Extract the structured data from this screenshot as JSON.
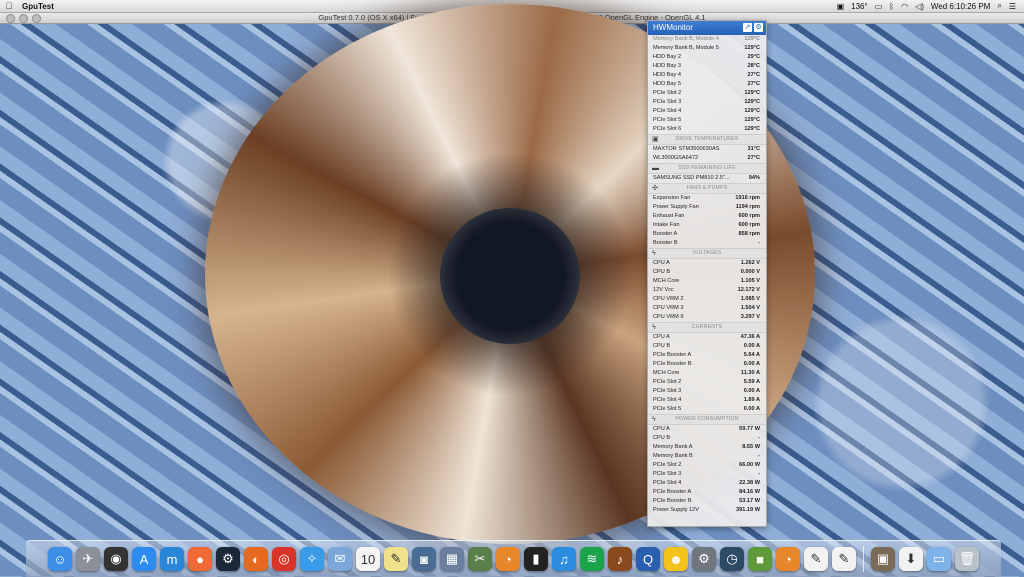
{
  "menubar": {
    "app_name": "GpuTest",
    "temp": "136°",
    "clock": "Wed 6:10:26 PM"
  },
  "gpu_window": {
    "title": "GpuTest 0.7.0 (OS X x64) | FurMark | 61 FPS, 16.959 ms | NVIDIA GeForce GTX 760 OpenGL Engine - OpenGL 4.1"
  },
  "hwmonitor": {
    "title": "HWMonitor",
    "top_rows": [
      {
        "label": "Memory Bank B, Module 4",
        "value": "129°C",
        "dim": true
      },
      {
        "label": "Memory Bank B, Module 5",
        "value": "129°C"
      },
      {
        "label": "HDD Bay 2",
        "value": "29°C"
      },
      {
        "label": "HDD Bay 3",
        "value": "28°C"
      },
      {
        "label": "HDD Bay 4",
        "value": "27°C"
      },
      {
        "label": "HDD Bay 5",
        "value": "27°C"
      },
      {
        "label": "PCIe Slot 2",
        "value": "129°C"
      },
      {
        "label": "PCIe Slot 3",
        "value": "129°C"
      },
      {
        "label": "PCIe Slot 4",
        "value": "129°C"
      },
      {
        "label": "PCIe Slot 5",
        "value": "129°C"
      },
      {
        "label": "PCIe Slot 6",
        "value": "129°C"
      }
    ],
    "sections": [
      {
        "title": "DRIVE TEMPERATURES",
        "icon": "▣",
        "rows": [
          {
            "label": "MAXTOR STM3500630AS",
            "value": "31°C"
          },
          {
            "label": "WL3000GSA6472",
            "value": "27°C"
          }
        ]
      },
      {
        "title": "SSD REMAINING LIFE",
        "icon": "▬",
        "rows": [
          {
            "label": "SAMSUNG SSD PM810 2.5\"...",
            "value": "94%"
          }
        ]
      },
      {
        "title": "FANS & PUMPS",
        "icon": "✣",
        "rows": [
          {
            "label": "Expansion Fan",
            "value": "1916 rpm"
          },
          {
            "label": "Power Supply Fan",
            "value": "1194 rpm"
          },
          {
            "label": "Exhaust Fan",
            "value": "600 rpm"
          },
          {
            "label": "Intake Fan",
            "value": "600 rpm"
          },
          {
            "label": "Booster A",
            "value": "858 rpm"
          },
          {
            "label": "Booster B",
            "value": "-"
          }
        ]
      },
      {
        "title": "VOLTAGES",
        "icon": "ϟ",
        "rows": [
          {
            "label": "CPU A",
            "value": "1.262 V"
          },
          {
            "label": "CPU B",
            "value": "0.000 V"
          },
          {
            "label": "MCH Core",
            "value": "1.105 V"
          },
          {
            "label": "12V Vcc",
            "value": "12.172 V"
          },
          {
            "label": "CPU VRM 2",
            "value": "1.085 V"
          },
          {
            "label": "CPU VRM 3",
            "value": "1.504 V"
          },
          {
            "label": "CPU VRM 9",
            "value": "3.297 V"
          }
        ]
      },
      {
        "title": "CURRENTS",
        "icon": "ϟ",
        "rows": [
          {
            "label": "CPU A",
            "value": "47.36 A"
          },
          {
            "label": "CPU B",
            "value": "0.00 A"
          },
          {
            "label": "PCIe Booster A",
            "value": "5.64 A"
          },
          {
            "label": "PCIe Booster B",
            "value": "0.00 A"
          },
          {
            "label": "MCH Core",
            "value": "11.30 A"
          },
          {
            "label": "PCIe Slot 2",
            "value": "5.59 A"
          },
          {
            "label": "PCIe Slot 3",
            "value": "0.00 A"
          },
          {
            "label": "PCIe Slot 4",
            "value": "1.89 A"
          },
          {
            "label": "PCIe Slot 5",
            "value": "0.00 A"
          }
        ]
      },
      {
        "title": "POWER CONSUMPTION",
        "icon": "ϟ",
        "rows": [
          {
            "label": "CPU A",
            "value": "59.77 W"
          },
          {
            "label": "CPU B",
            "value": "-"
          },
          {
            "label": "Memory Bank A",
            "value": "8.55 W"
          },
          {
            "label": "Memory Bank B",
            "value": "-"
          },
          {
            "label": "PCIe Slot 2",
            "value": "66.00 W"
          },
          {
            "label": "PCIe Slot 3",
            "value": "-"
          },
          {
            "label": "PCIe Slot 4",
            "value": "22.38 W"
          },
          {
            "label": "PCIe Booster A",
            "value": "84.16 W"
          },
          {
            "label": "PCIe Booster B",
            "value": "53.17 W"
          },
          {
            "label": "Power Supply 12V",
            "value": "391.19 W"
          }
        ]
      }
    ]
  },
  "dock": {
    "items": [
      {
        "name": "finder",
        "glyph": "☺",
        "color": "#3c8ee6"
      },
      {
        "name": "launchpad",
        "glyph": "✈",
        "color": "#8a8f99"
      },
      {
        "name": "dashboard",
        "glyph": "◉",
        "color": "#333333"
      },
      {
        "name": "app-store",
        "glyph": "A",
        "color": "#2d8cf0"
      },
      {
        "name": "m-app",
        "glyph": "m",
        "color": "#2a86d8"
      },
      {
        "name": "maps-pin",
        "glyph": "●",
        "color": "#f06a35"
      },
      {
        "name": "steam",
        "glyph": "⚙",
        "color": "#1b2838"
      },
      {
        "name": "firefox",
        "glyph": "◐",
        "color": "#e66a1f"
      },
      {
        "name": "chrome",
        "glyph": "◎",
        "color": "#d8342a"
      },
      {
        "name": "safari",
        "glyph": "✧",
        "color": "#3a9be8"
      },
      {
        "name": "mail",
        "glyph": "✉",
        "color": "#7aa6d8"
      },
      {
        "name": "calendar",
        "glyph": "10",
        "color": "#f4f4f4"
      },
      {
        "name": "notes",
        "glyph": "✎",
        "color": "#f0e28a"
      },
      {
        "name": "camera",
        "glyph": "◙",
        "color": "#4a6c92"
      },
      {
        "name": "preview",
        "glyph": "▦",
        "color": "#6a7fa0"
      },
      {
        "name": "tools",
        "glyph": "✂",
        "color": "#5a7f4a"
      },
      {
        "name": "blender",
        "glyph": "◔",
        "color": "#e8872a"
      },
      {
        "name": "clapper",
        "glyph": "▮",
        "color": "#222222"
      },
      {
        "name": "itunes",
        "glyph": "♫",
        "color": "#2a8de0"
      },
      {
        "name": "spotify",
        "glyph": "≋",
        "color": "#1aa34a"
      },
      {
        "name": "guitar",
        "glyph": "♪",
        "color": "#8a4a1e"
      },
      {
        "name": "quicktime",
        "glyph": "Q",
        "color": "#2a5fb0"
      },
      {
        "name": "smiley",
        "glyph": "☻",
        "color": "#f2c31a"
      },
      {
        "name": "system-prefs",
        "glyph": "⚙",
        "color": "#6f7680"
      },
      {
        "name": "time-machine",
        "glyph": "◷",
        "color": "#2d4b64"
      },
      {
        "name": "minecraft",
        "glyph": "■",
        "color": "#5f9a3a"
      },
      {
        "name": "blender2",
        "glyph": "◔",
        "color": "#e8872a"
      },
      {
        "name": "document-a",
        "glyph": "✎",
        "color": "#f2f2f2"
      },
      {
        "name": "document-b",
        "glyph": "✎",
        "color": "#f2f2f2"
      },
      {
        "name": "photo-stack",
        "glyph": "▣",
        "color": "#7a6a58"
      },
      {
        "name": "downloads-doc",
        "glyph": "⬇",
        "color": "#f2f2f2"
      },
      {
        "name": "folder",
        "glyph": "▭",
        "color": "#7fb2e8"
      },
      {
        "name": "trash",
        "glyph": "🗑",
        "color": "#b8c0c8"
      }
    ]
  }
}
